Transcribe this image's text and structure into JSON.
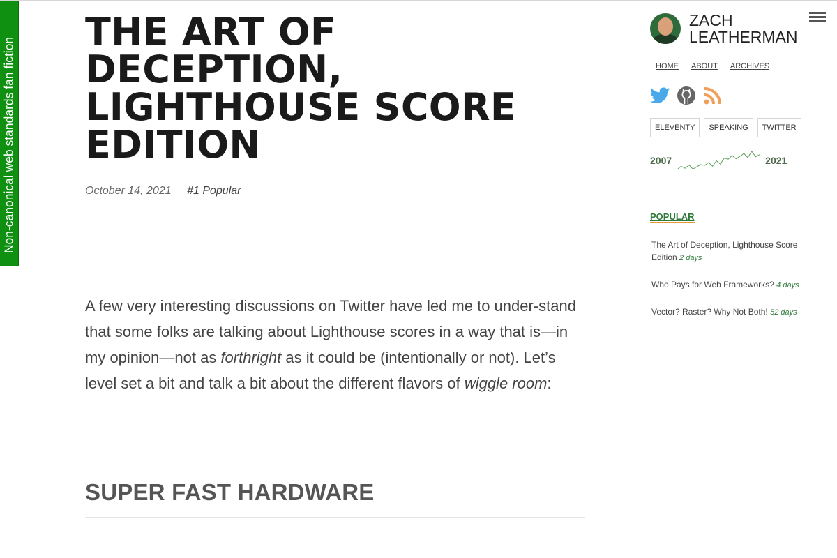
{
  "ribbon": {
    "text": "Non-canonical web standards fan fiction"
  },
  "article": {
    "title": "THE ART OF DECEPTION, LIGHTHOUSE SCORE EDITION",
    "date": "October 14, 2021",
    "tag": "#1 Popular",
    "lead_parts": [
      "A few very interesting discussions on Twitter have led me to under-stand that some folks are talking about Lighthouse scores in a way that is—in my opinion—not as ",
      "forthright",
      " as it could be (intentionally or not). Let’s level set a bit and talk a bit about the different flavors of ",
      "wiggle room",
      ":"
    ],
    "section_heading": "SUPER FAST HARDWARE"
  },
  "sidebar": {
    "brand_first": "ZACH",
    "brand_last": "LEATHERMAN",
    "nav": [
      "HOME",
      "ABOUT",
      "ARCHIVES"
    ],
    "social_icons": [
      "twitter-icon",
      "github-icon",
      "rss-icon"
    ],
    "pills": [
      "ELEVENTY",
      "SPEAKING",
      "TWITTER"
    ],
    "sparkline": {
      "start_year": "2007",
      "end_year": "2021",
      "values": [
        1,
        9,
        4,
        12,
        2,
        8,
        13,
        11,
        18,
        9,
        22,
        14,
        29,
        26,
        35,
        27,
        33,
        40,
        30,
        45,
        32,
        37
      ],
      "color": "#5aa05a"
    },
    "popular_heading": "POPULAR",
    "popular": [
      {
        "title": "The Art of Deception, Lighthouse Score Edition",
        "ago": "2 days"
      },
      {
        "title": "Who Pays for Web Frameworks?",
        "ago": "4 days"
      },
      {
        "title": "Vector? Raster? Why Not Both!",
        "ago": "52 days"
      }
    ]
  },
  "colors": {
    "ribbon": "#109010",
    "accent": "#2f7a3a",
    "twitter": "#4aa9e9",
    "rss": "#f0a05a"
  }
}
